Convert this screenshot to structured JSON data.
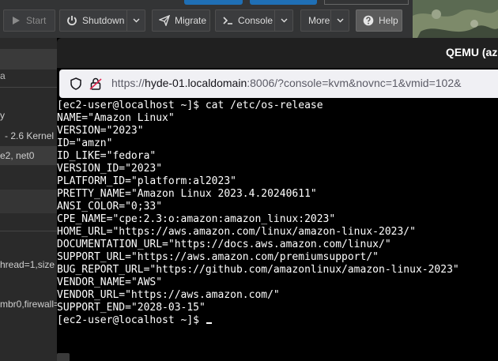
{
  "toolbar": {
    "start": "Start",
    "shutdown": "Shutdown",
    "migrate": "Migrate",
    "console": "Console",
    "more": "More",
    "help": "Help"
  },
  "left_panel": {
    "rows": [
      "a",
      "y",
      "- 2.6 Kernel",
      "e2, net0",
      "hread=1,size",
      "mbr0,firewall="
    ]
  },
  "window": {
    "title": "QEMU (az",
    "url_prefix": "https://",
    "url_host": "hyde-01.localdomain",
    "url_rest": ":8006/?console=kvm&novnc=1&vmid=102&"
  },
  "terminal": {
    "lines": [
      "[ec2-user@localhost ~]$ cat /etc/os-release",
      "NAME=\"Amazon Linux\"",
      "VERSION=\"2023\"",
      "ID=\"amzn\"",
      "ID_LIKE=\"fedora\"",
      "VERSION_ID=\"2023\"",
      "PLATFORM_ID=\"platform:al2023\"",
      "PRETTY_NAME=\"Amazon Linux 2023.4.20240611\"",
      "ANSI_COLOR=\"0;33\"",
      "CPE_NAME=\"cpe:2.3:o:amazon:amazon_linux:2023\"",
      "HOME_URL=\"https://aws.amazon.com/linux/amazon-linux-2023/\"",
      "DOCUMENTATION_URL=\"https://docs.aws.amazon.com/linux/\"",
      "SUPPORT_URL=\"https://aws.amazon.com/premiumsupport/\"",
      "BUG_REPORT_URL=\"https://github.com/amazonlinux/amazon-linux-2023\"",
      "VENDOR_NAME=\"AWS\"",
      "VENDOR_URL=\"https://aws.amazon.com/\"",
      "SUPPORT_END=\"2028-03-15\"",
      "[ec2-user@localhost ~]$ "
    ]
  },
  "icons": {
    "start": "play-icon",
    "shutdown": "power-icon",
    "migrate": "send-icon",
    "console": "terminal-icon",
    "help": "question-icon",
    "url_shield": "shield-icon",
    "url_lock": "lock-icon"
  },
  "colors": {
    "toolbar_bg": "#333435",
    "button_bg": "#3b3c3e",
    "accent_blue": "#1f6fb5",
    "terminal_bg": "#000000",
    "terminal_fg": "#ffffff",
    "urlbar_bg": "#f0f0f4"
  }
}
